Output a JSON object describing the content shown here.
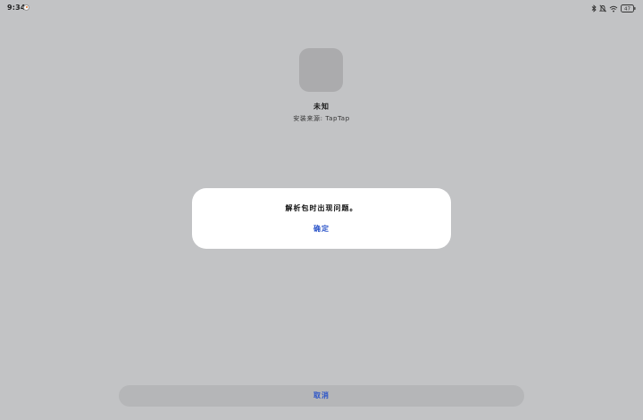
{
  "status_bar": {
    "time": "9:34",
    "app_notification_icon": "app-notification-icon",
    "icons": [
      "bluetooth-icon",
      "mute-icon",
      "wifi-icon",
      "battery-icon"
    ],
    "battery_level": "47"
  },
  "app": {
    "icon": "app-icon-placeholder",
    "name": "未知",
    "install_source": "安装来源: TapTap"
  },
  "dialog": {
    "message": "解析包时出现问题。",
    "confirm_label": "确定"
  },
  "bottom": {
    "cancel_label": "取消"
  },
  "colors": {
    "background": "#c2c3c5",
    "accent": "#2c55c9",
    "dialog": "#ffffff",
    "cancel_bar": "#b5b6b8"
  }
}
